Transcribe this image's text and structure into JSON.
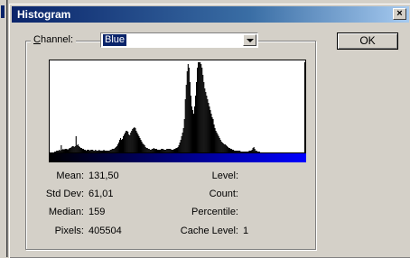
{
  "window": {
    "title": "Histogram",
    "close_label": "×",
    "ok_label": "OK"
  },
  "channel": {
    "label_prefix": "",
    "label_accel": "C",
    "label_rest": "hannel:",
    "selected": "Blue"
  },
  "stats": {
    "mean_label": "Mean:",
    "mean_value": "131,50",
    "stddev_label": "Std Dev:",
    "stddev_value": "61,01",
    "median_label": "Median:",
    "median_value": "159",
    "pixels_label": "Pixels:",
    "pixels_value": "405504",
    "level_label": "Level:",
    "level_value": "",
    "count_label": "Count:",
    "count_value": "",
    "percentile_label": "Percentile:",
    "percentile_value": "",
    "cache_label": "Cache Level:",
    "cache_value": "1"
  },
  "colors": {
    "titlebar_start": "#0a246a",
    "titlebar_end": "#a6caf0",
    "gradient_end": "#0000ff"
  },
  "histogram": {
    "bins": [
      0,
      0,
      0,
      1,
      1,
      2,
      3,
      4,
      5,
      6,
      7,
      6,
      20,
      8,
      9,
      8,
      10,
      9,
      9,
      8,
      10,
      12,
      14,
      16,
      18,
      17,
      16,
      18,
      45,
      20,
      22,
      18,
      16,
      14,
      12,
      10,
      9,
      8,
      7,
      6,
      7,
      8,
      7,
      6,
      7,
      8,
      7,
      6,
      6,
      7,
      6,
      5,
      6,
      7,
      6,
      6,
      5,
      6,
      7,
      6,
      6,
      6,
      5,
      6,
      6,
      7,
      8,
      9,
      10,
      11,
      12,
      15,
      18,
      22,
      28,
      35,
      40,
      35,
      38,
      45,
      50,
      55,
      60,
      62,
      58,
      52,
      48,
      55,
      62,
      66,
      70,
      72,
      68,
      60,
      55,
      50,
      45,
      40,
      35,
      30,
      25,
      22,
      20,
      16,
      14,
      12,
      10,
      9,
      8,
      8,
      9,
      10,
      12,
      11,
      10,
      9,
      8,
      8,
      7,
      8,
      9,
      10,
      9,
      8,
      7,
      8,
      9,
      10,
      11,
      10,
      9,
      8,
      7,
      8,
      9,
      10,
      12,
      14,
      16,
      20,
      28,
      35,
      45,
      55,
      70,
      95,
      150,
      190,
      230,
      250,
      240,
      200,
      160,
      130,
      120,
      110,
      130,
      160,
      200,
      240,
      255,
      255,
      255,
      250,
      240,
      220,
      200,
      180,
      170,
      160,
      150,
      140,
      130,
      120,
      110,
      100,
      95,
      80,
      70,
      60,
      55,
      50,
      45,
      40,
      35,
      30,
      28,
      26,
      24,
      22,
      20,
      18,
      16,
      14,
      12,
      10,
      9,
      8,
      7,
      6,
      6,
      5,
      5,
      4,
      4,
      4,
      3,
      3,
      3,
      3,
      3,
      2,
      2,
      2,
      3,
      4,
      5,
      6,
      8,
      12,
      16,
      10,
      6,
      4,
      3,
      2,
      2,
      1,
      1,
      1,
      1,
      1,
      1,
      1,
      1,
      0,
      0,
      0,
      0,
      0,
      0,
      0,
      0,
      0,
      0,
      0,
      0,
      0,
      0,
      0,
      0,
      0,
      0,
      0,
      0,
      0,
      0,
      0,
      0,
      0,
      0,
      0,
      0,
      0,
      0,
      0,
      0,
      0,
      0,
      0,
      0,
      0,
      0,
      0,
      0,
      255
    ]
  }
}
